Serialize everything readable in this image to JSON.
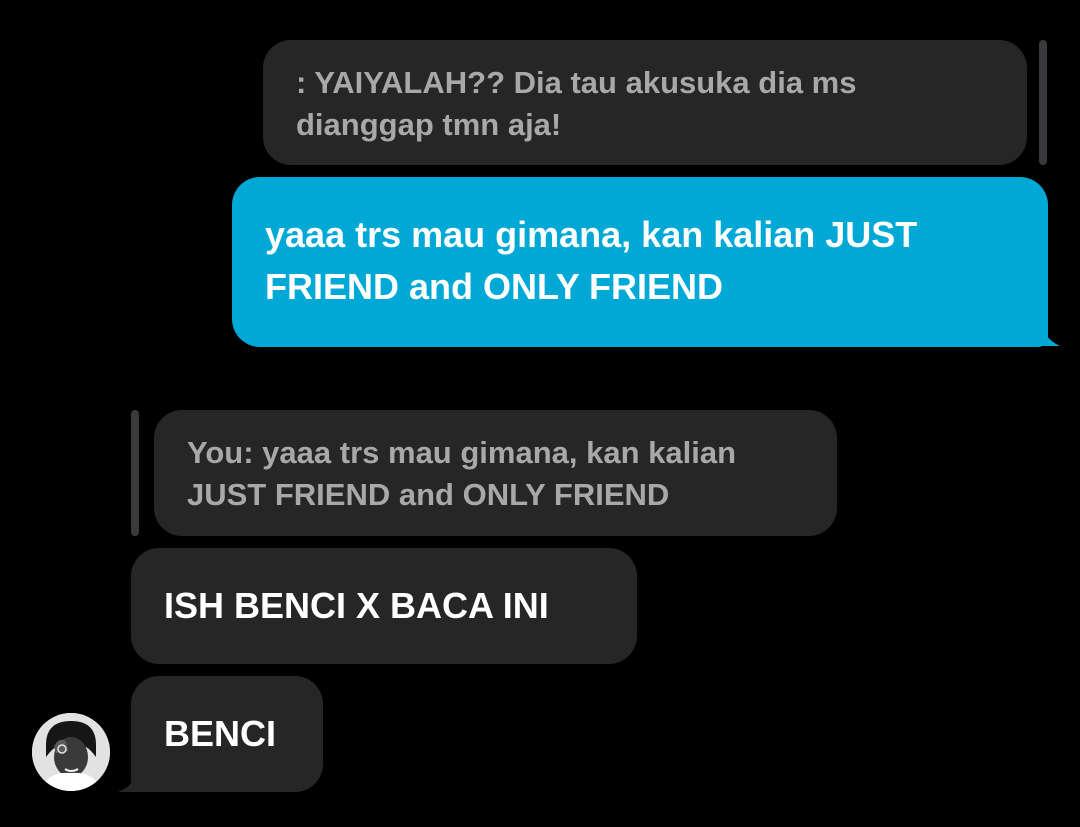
{
  "conversation": {
    "messages": [
      {
        "kind": "reply-preview",
        "direction": "outgoing",
        "text": "    : YAIYALAH?? Dia tau akusuka dia ms\ndianggap tmn aja!"
      },
      {
        "kind": "message",
        "direction": "outgoing",
        "text": "yaaa trs mau gimana, kan kalian JUST\nFRIEND and ONLY FRIEND"
      },
      {
        "kind": "reply-preview",
        "direction": "incoming",
        "text": "You: yaaa trs mau gimana, kan kalian\nJUST FRIEND and ONLY FRIEND"
      },
      {
        "kind": "message",
        "direction": "incoming",
        "text": "ISH BENCI X BACA INI"
      },
      {
        "kind": "message",
        "direction": "incoming",
        "text": "BENCI"
      }
    ],
    "contact": {
      "avatar_icon": "profile-photo"
    }
  },
  "colors": {
    "background": "#000000",
    "sent_bubble": "#00a8d6",
    "received_bubble": "#262626",
    "quoted_text": "#a8a8a8",
    "message_text": "#ffffff"
  }
}
